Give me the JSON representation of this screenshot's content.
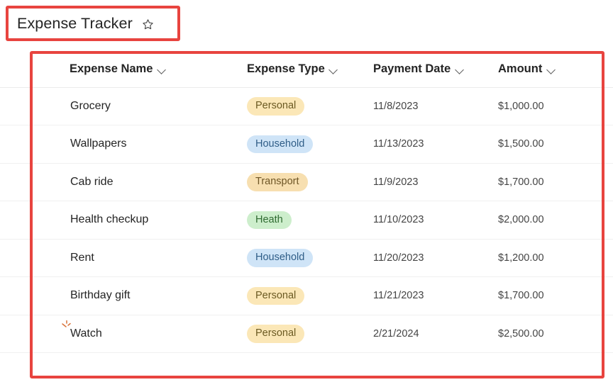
{
  "header": {
    "title": "Expense Tracker",
    "favorite_icon": "star-outline-icon"
  },
  "table": {
    "columns": [
      {
        "label": "Expense Name",
        "sort_icon": "chevron-down-icon"
      },
      {
        "label": "Expense Type",
        "sort_icon": "chevron-down-icon"
      },
      {
        "label": "Payment Date",
        "sort_icon": "chevron-down-icon"
      },
      {
        "label": "Amount",
        "sort_icon": "chevron-down-icon"
      }
    ],
    "rows": [
      {
        "name": "Grocery",
        "type": "Personal",
        "type_style": "personal",
        "date": "11/8/2023",
        "amount": "$1,000.00",
        "cursor": false
      },
      {
        "name": "Wallpapers",
        "type": "Household",
        "type_style": "household",
        "date": "11/13/2023",
        "amount": "$1,500.00",
        "cursor": false
      },
      {
        "name": "Cab ride",
        "type": "Transport",
        "type_style": "transport",
        "date": "11/9/2023",
        "amount": "$1,700.00",
        "cursor": false
      },
      {
        "name": "Health checkup",
        "type": "Heath",
        "type_style": "heath",
        "date": "11/10/2023",
        "amount": "$2,000.00",
        "cursor": false
      },
      {
        "name": "Rent",
        "type": "Household",
        "type_style": "household",
        "date": "11/20/2023",
        "amount": "$1,200.00",
        "cursor": false
      },
      {
        "name": "Birthday gift",
        "type": "Personal",
        "type_style": "personal",
        "date": "11/21/2023",
        "amount": "$1,700.00",
        "cursor": false
      },
      {
        "name": "Watch",
        "type": "Personal",
        "type_style": "personal",
        "date": "2/21/2024",
        "amount": "$2,500.00",
        "cursor": true
      }
    ]
  },
  "annotations": {
    "color": "#e8443f",
    "boxes": [
      {
        "name": "title-highlight"
      },
      {
        "name": "table-highlight"
      }
    ]
  },
  "colors": {
    "text": "#242424",
    "row_divider": "#f0f0f0",
    "header_divider": "#ebebeb",
    "badge_personal_bg": "#fbe7b7",
    "badge_household_bg": "#cfe4f7",
    "badge_transport_bg": "#f7dfb0",
    "badge_heath_bg": "#cdeecc"
  }
}
